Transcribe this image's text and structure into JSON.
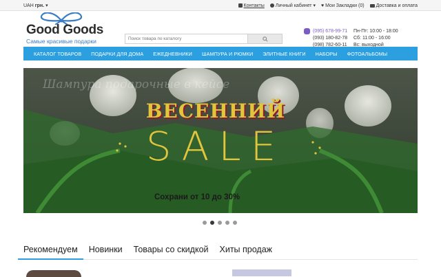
{
  "topbar": {
    "currency_label": "UAH",
    "currency_suffix": "грн.",
    "links": {
      "contacts": "Контакты",
      "account": "Личный кабинет",
      "wishlist": "Мои Закладки (0)",
      "delivery": "Доставка и оплата"
    }
  },
  "logo": {
    "brand": "Good Goods",
    "tagline": "Самые красивые подарки"
  },
  "search": {
    "placeholder": "Поиск товара по каталогу"
  },
  "contacts": {
    "phones": [
      "(095) 678-99-71",
      "(093) 180-82-78",
      "(098) 782-60-11"
    ],
    "hours": [
      "Пн-Пт: 10:00 - 18:00",
      "Сб: 11:00 - 16:00",
      "Вс: выходной"
    ]
  },
  "nav": {
    "items": [
      "Каталог товаров",
      "Подарки для дома",
      "Ежедневники",
      "Шампура и рюмки",
      "Элитные книги",
      "Наборы",
      "Фотоальбомы"
    ]
  },
  "banner": {
    "script_text": "Шампура подарочные в кейсе",
    "headline_top": "ВЕСЕННИЙ",
    "headline_main": "SALE",
    "subtitle": "Сохрани от 10 до 30%",
    "active_slide": 2,
    "slide_count": 5
  },
  "tabs": [
    "Рекомендуем",
    "Новинки",
    "Товары со скидкой",
    "Хиты продаж"
  ],
  "colors": {
    "accent": "#2b9fe0",
    "sale_gold": "#e1c53c",
    "viber": "#7b5cc4"
  }
}
